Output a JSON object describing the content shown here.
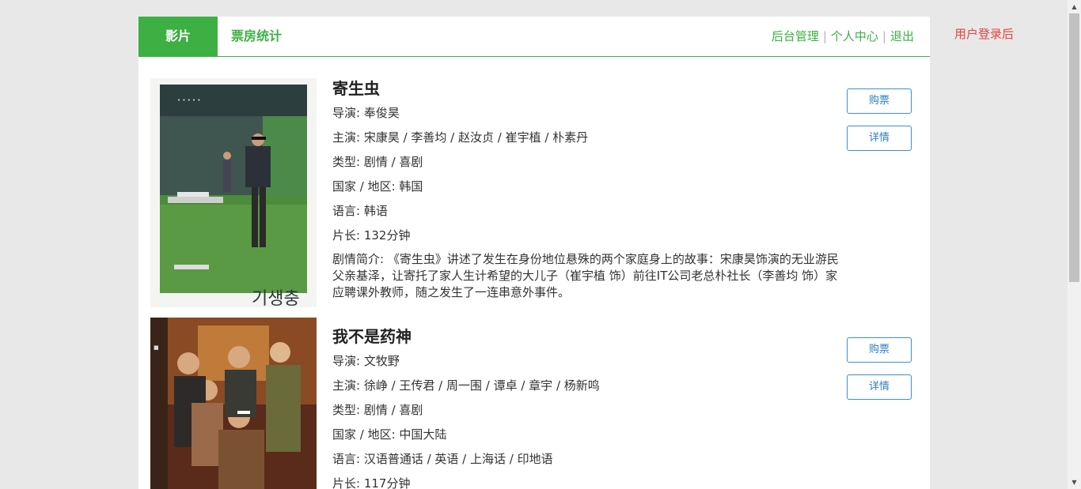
{
  "nav": {
    "tabs": [
      "影片",
      "票房统计"
    ],
    "links": [
      "后台管理",
      "个人中心",
      "退出"
    ],
    "separator": "|"
  },
  "login_note": "用户登录后",
  "colors": {
    "brand_green": "#3cb043",
    "button_blue": "#2a7fc6",
    "alert_red": "#e8403d"
  },
  "movies": [
    {
      "title": "寄生虫",
      "poster_text": "기생충",
      "director": "导演: 奉俊昊",
      "cast": "主演: 宋康昊 / 李善均 / 赵汝贞 / 崔宇植 / 朴素丹",
      "genre": "类型: 剧情 / 喜剧",
      "country": "国家 / 地区: 韩国",
      "language": "语言: 韩语",
      "runtime": "片长: 132分钟",
      "synopsis": "剧情简介: 《寄生虫》讲述了发生在身份地位悬殊的两个家庭身上的故事：宋康昊饰演的无业游民父亲基泽，让寄托了家人生计希望的大儿子（崔宇植 饰）前往IT公司老总朴社长（李善均 饰）家应聘课外教师，随之发生了一连串意外事件。",
      "buy_label": "购票",
      "detail_label": "详情"
    },
    {
      "title": "我不是药神",
      "director": "导演: 文牧野",
      "cast": "主演:  徐峥 / 王传君 / 周一围 / 谭卓 / 章宇 / 杨新鸣",
      "genre": "类型: 剧情 / 喜剧",
      "country": "国家 / 地区: 中国大陆",
      "language": "语言: 汉语普通话 / 英语 / 上海话 / 印地语",
      "runtime": "片长: 117分钟",
      "buy_label": "购票",
      "detail_label": "详情"
    }
  ]
}
